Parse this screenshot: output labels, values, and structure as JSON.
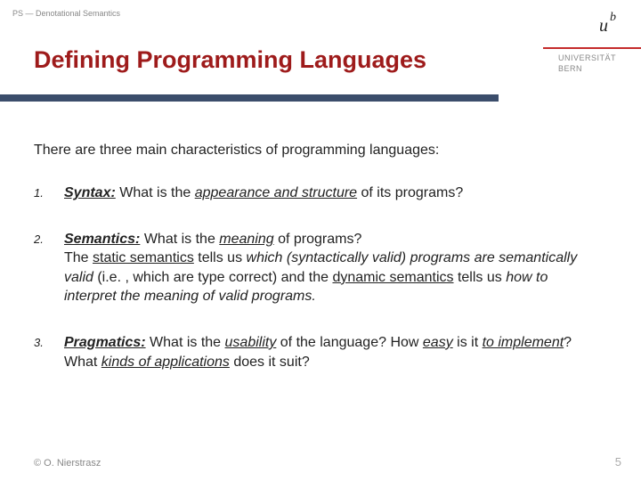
{
  "breadcrumb": "PS — Denotational Semantics",
  "title": "Defining Programming Languages",
  "logo": {
    "mark_main": "u",
    "mark_sup": "b",
    "line1": "UNIVERSITÄT",
    "line2": "BERN"
  },
  "intro": "There are three main characteristics of programming languages:",
  "items": [
    {
      "num": "1.",
      "term": "Syntax:",
      "q_prefix": " What is the ",
      "q_em": "appearance and structure",
      "q_suffix": " of its programs?"
    },
    {
      "num": "2.",
      "term": "Semantics:",
      "q_prefix": " What is the ",
      "q_em": "meaning",
      "q_suffix": " of programs?",
      "detail_a": "The ",
      "detail_static": "static semantics",
      "detail_b": " tells us ",
      "detail_which": "which (syntactically valid) programs are semantically valid",
      "detail_c": " (i.e. , which are type correct) and the ",
      "detail_dynamic": "dynamic semantics",
      "detail_d": " tells us ",
      "detail_how": "how to interpret the meaning of valid programs.",
      "detail_e": ""
    },
    {
      "num": "3.",
      "term": "Pragmatics:",
      "q_prefix": " What is the ",
      "q_em": "usability",
      "q_suffix": " of the language? How ",
      "p_easy": "easy",
      "p_mid1": " is it ",
      "p_impl": "to implement",
      "p_mid2": "? What ",
      "p_apps": "kinds of applications",
      "p_end": " does it suit?"
    }
  ],
  "footer": {
    "copyright": "© O. Nierstrasz",
    "page": "5"
  }
}
